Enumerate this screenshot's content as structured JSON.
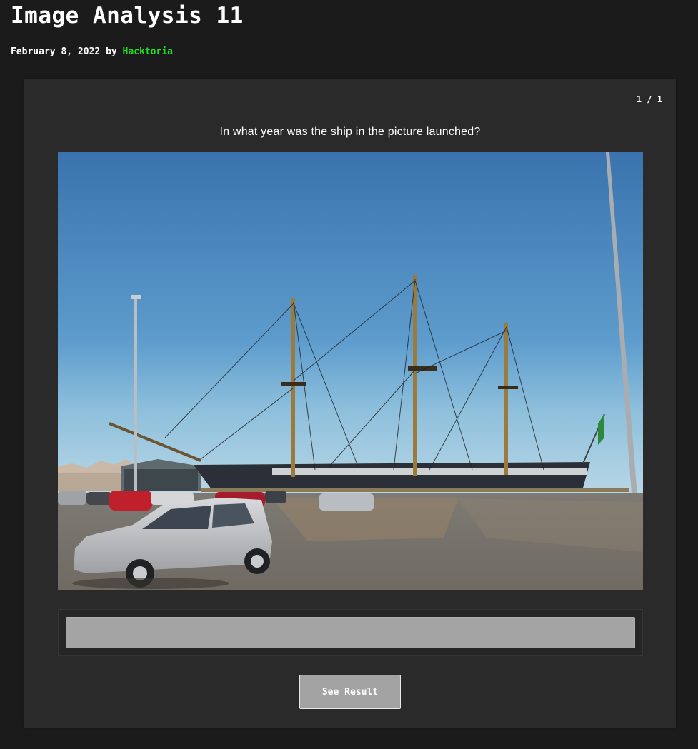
{
  "post": {
    "title": "Image Analysis 11",
    "date": "February 8, 2022",
    "by_label": "by",
    "author": "Hacktoria",
    "author_color": "#22e022"
  },
  "quiz": {
    "counter": "1 / 1",
    "question": "In what year was the ship in the picture launched?",
    "image_description_icon": "photo-ship-harbor",
    "answer": {
      "value": "",
      "placeholder": ""
    },
    "submit_label": "See Result"
  }
}
